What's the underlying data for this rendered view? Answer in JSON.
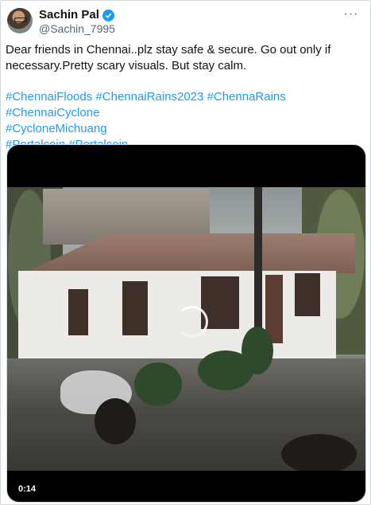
{
  "author": {
    "name": "Sachin Pal",
    "handle": "@Sachin_7995",
    "verified": true,
    "badge_color": "#1d9bf0"
  },
  "menu": {
    "icon": "more-horizontal-icon",
    "label": "···"
  },
  "post": {
    "text": "Dear friends in Chennai..plz stay safe & secure. Go out only if necessary.Pretty scary visuals. But stay calm.",
    "hashtags": [
      "#ChennaiFloods",
      "#ChennaiRains2023",
      "#ChennaRains",
      "#ChennaiCyclone",
      "#CycloneMichuang",
      "#Portalcoin",
      "#Portalcoin"
    ]
  },
  "media": {
    "type": "video",
    "duration": "0:14",
    "loading_icon": "spinner-icon"
  },
  "colors": {
    "link": "#1d9bf0",
    "text": "#0f1419",
    "muted": "#536471"
  }
}
